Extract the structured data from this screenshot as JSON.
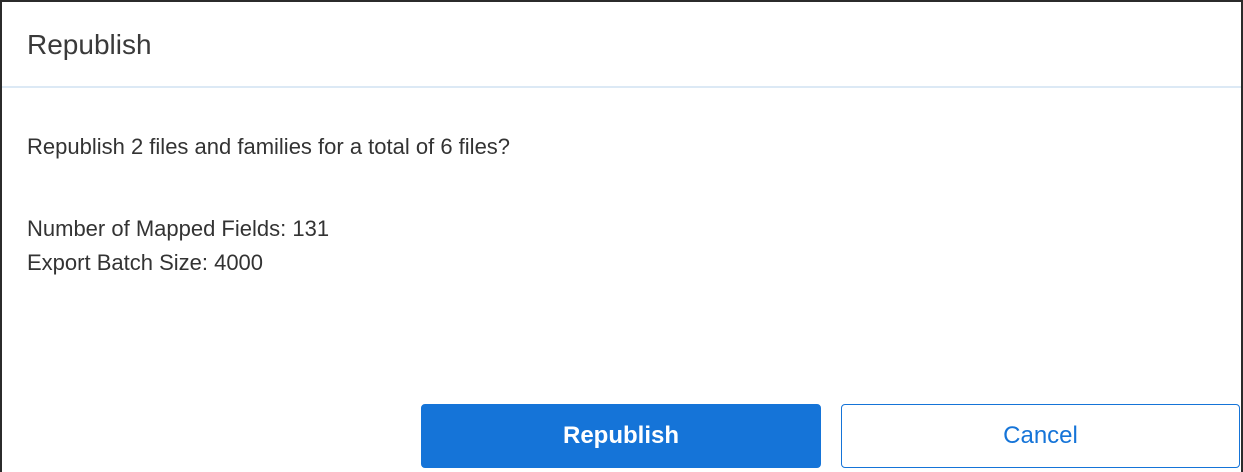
{
  "dialog": {
    "title": "Republish",
    "message": "Republish 2 files and families for a total of 6 files?",
    "details": {
      "mapped_fields": "Number of Mapped Fields: 131",
      "batch_size": "Export Batch Size: 4000"
    },
    "buttons": {
      "confirm_label": "Republish",
      "cancel_label": "Cancel"
    }
  },
  "colors": {
    "primary": "#1574d8",
    "divider": "#dce9f5",
    "text": "#333333"
  }
}
